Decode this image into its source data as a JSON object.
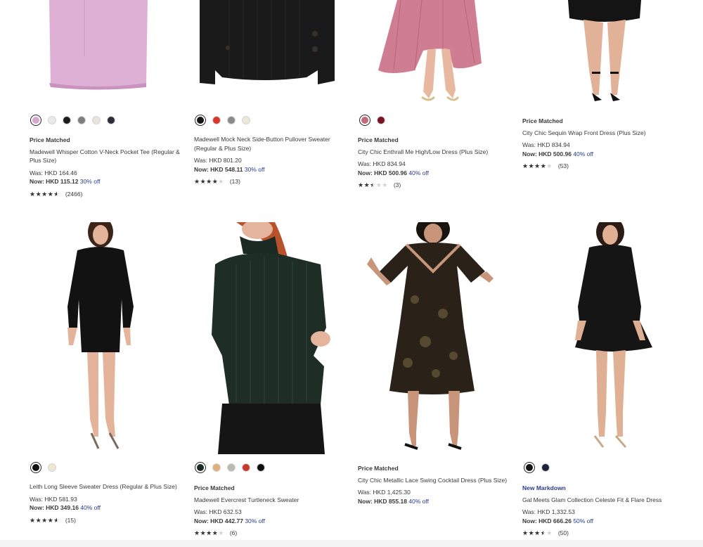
{
  "products": [
    {
      "swatches": [
        {
          "color": "#d9a6cf",
          "selected": true
        },
        {
          "color": "#eaeaea",
          "selected": false
        },
        {
          "color": "#1b1b1b",
          "selected": false
        },
        {
          "color": "#7d7d7d",
          "selected": false
        },
        {
          "color": "#e7e3df",
          "selected": false
        },
        {
          "color": "#2b2e3a",
          "selected": false
        }
      ],
      "tag": "Price Matched",
      "name": "Madewell Whisper Cotton V-Neck Pocket Tee (Regular & Plus Size)",
      "was": "Was: HKD 164.46",
      "now_label": "Now:",
      "now_price": "HKD 115.12",
      "off": "30% off",
      "rating": 4.5,
      "reviews": "(2466)"
    },
    {
      "swatches": [
        {
          "color": "#141414",
          "selected": true
        },
        {
          "color": "#d9362b",
          "selected": false
        },
        {
          "color": "#8a8a8a",
          "selected": false
        },
        {
          "color": "#ece7d8",
          "selected": false
        }
      ],
      "tag": "",
      "name": "Madewell Mock Neck Side-Button Pullover Sweater (Regular & Plus Size)",
      "was": "Was: HKD 801.20",
      "now_label": "Now:",
      "now_price": "HKD 548.11",
      "off": "30% off",
      "rating": 4,
      "reviews": "(13)"
    },
    {
      "swatches": [
        {
          "color": "#c06a7a",
          "selected": true
        },
        {
          "color": "#7a1325",
          "selected": false
        }
      ],
      "tag": "Price Matched",
      "name": "City Chic Enthrall Me High/Low Dress (Plus Size)",
      "was": "Was: HKD 834.94",
      "now_label": "Now:",
      "now_price": "HKD 500.96",
      "off": "40% off",
      "rating": 2.5,
      "reviews": "(3)"
    },
    {
      "swatches": [],
      "tag": "Price Matched",
      "name": "City Chic Sequin Wrap Front Dress (Plus Size)",
      "was": "Was: HKD 834.94",
      "now_label": "Now:",
      "now_price": "HKD 500.96",
      "off": "40% off",
      "rating": 4,
      "reviews": "(53)"
    },
    {
      "swatches": [
        {
          "color": "#111111",
          "selected": true
        },
        {
          "color": "#efe6d3",
          "selected": false
        }
      ],
      "tag": "",
      "name": "Leith Long Sleeve Sweater Dress (Regular & Plus Size)",
      "was": "Was: HKD 581.93",
      "now_label": "Now:",
      "now_price": "HKD 349.16",
      "off": "40% off",
      "rating": 4.5,
      "reviews": "(15)"
    },
    {
      "swatches": [
        {
          "color": "#1b2a22",
          "selected": true
        },
        {
          "color": "#e0b07a",
          "selected": false
        },
        {
          "color": "#b9bcae",
          "selected": false
        },
        {
          "color": "#c9382c",
          "selected": false
        },
        {
          "color": "#0e0e0e",
          "selected": false
        }
      ],
      "tag": "Price Matched",
      "name": "Madewell Evercrest Turtleneck Sweater",
      "was": "Was: HKD 632.53",
      "now_label": "Now:",
      "now_price": "HKD 442.77",
      "off": "30% off",
      "rating": 4,
      "reviews": "(6)"
    },
    {
      "swatches": [],
      "tag": "Price Matched",
      "name": "City Chic Metallic Lace Swing Cocktail Dress (Plus Size)",
      "was": "Was: HKD 1,425.30",
      "now_label": "Now:",
      "now_price": "HKD 855.18",
      "off": "40% off",
      "rating": null,
      "reviews": ""
    },
    {
      "swatches": [
        {
          "color": "#141414",
          "selected": true
        },
        {
          "color": "#1c2135",
          "selected": false
        }
      ],
      "tag": "New Markdown",
      "name": "Gal Meets Glam Collection Celeste Fit & Flare Dress",
      "was": "Was: HKD 1,332.53",
      "now_label": "Now:",
      "now_price": "HKD 666.26",
      "off": "50% off",
      "rating": 3.5,
      "reviews": "(50)"
    }
  ]
}
